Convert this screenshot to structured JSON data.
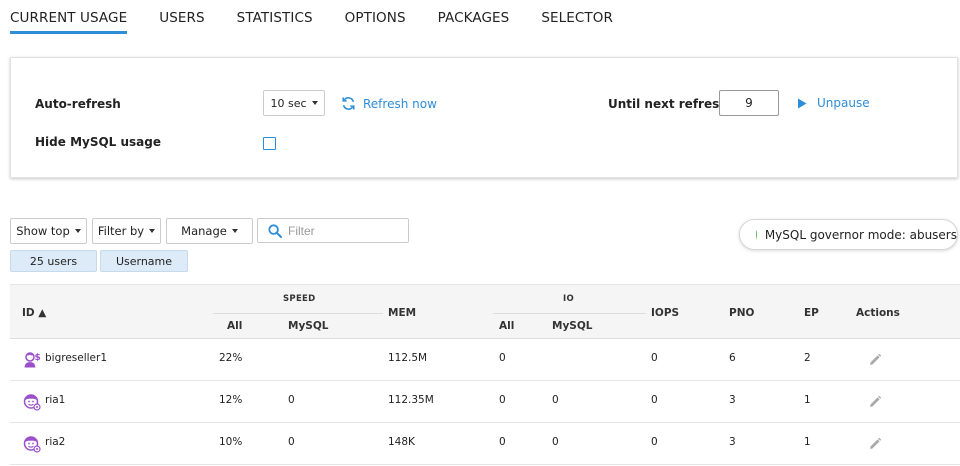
{
  "tabs": [
    {
      "label": "CURRENT USAGE",
      "active": true
    },
    {
      "label": "USERS"
    },
    {
      "label": "STATISTICS"
    },
    {
      "label": "OPTIONS"
    },
    {
      "label": "PACKAGES"
    },
    {
      "label": "SELECTOR"
    }
  ],
  "refresh_panel": {
    "auto_refresh_label": "Auto-refresh",
    "interval_value": "10 sec",
    "refresh_now_label": "Refresh now",
    "until_next_label": "Until next refresh",
    "countdown_value": "9",
    "unpause_label": "Unpause",
    "hide_mysql_label": "Hide MySQL usage",
    "hide_mysql_checked": false
  },
  "toolbar": {
    "show_top_label": "Show top",
    "filter_by_label": "Filter by",
    "manage_label": "Manage",
    "filter_placeholder": "Filter",
    "chip_users": "25 users",
    "chip_field": "Username",
    "governor_mode": "MySQL governor mode: abusers"
  },
  "table": {
    "headers": {
      "id": "ID ▲",
      "speed": "SPEED",
      "speed_all": "All",
      "speed_mysql": "MySQL",
      "mem": "MEM",
      "io": "IO",
      "io_all": "All",
      "io_mysql": "MySQL",
      "iops": "IOPS",
      "pno": "PNO",
      "ep": "EP",
      "actions": "Actions"
    },
    "rows": [
      {
        "id": "bigreseller1",
        "type": "reseller",
        "speed_all": "22%",
        "speed_mysql": "",
        "mem": "112.5M",
        "io_all": "0",
        "io_mysql": "",
        "iops": "0",
        "pno": "6",
        "ep": "2"
      },
      {
        "id": "ria1",
        "type": "user",
        "speed_all": "12%",
        "speed_mysql": "0",
        "mem": "112.35M",
        "io_all": "0",
        "io_mysql": "0",
        "iops": "0",
        "pno": "3",
        "ep": "1"
      },
      {
        "id": "ria2",
        "type": "user",
        "speed_all": "10%",
        "speed_mysql": "0",
        "mem": "148K",
        "io_all": "0",
        "io_mysql": "0",
        "iops": "0",
        "pno": "3",
        "ep": "1"
      }
    ]
  },
  "colors": {
    "accent": "#2d8dd7",
    "chip_bg": "#dcebf7",
    "status_dot": "#5fbf6a",
    "avatar": "#9b4fc9"
  },
  "icons": {
    "refresh": "refresh-icon",
    "play": "play-icon",
    "search": "search-icon",
    "edit": "pencil-icon",
    "reseller_avatar": "reseller-avatar-icon",
    "user_avatar": "user-avatar-icon"
  }
}
